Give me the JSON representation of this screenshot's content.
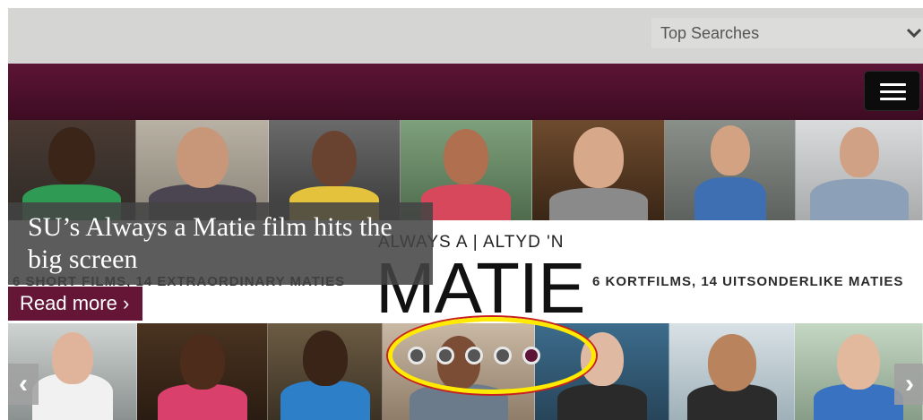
{
  "header": {
    "search_select": {
      "selected": "Top Searches",
      "icon": "chevron-down-icon"
    },
    "menu_button": {
      "icon": "hamburger-icon"
    }
  },
  "banner": {
    "brand_small": "ALWAYS A | ALTYD 'N",
    "brand_large": "MATIE",
    "tagline_en": "6 SHORT FILMS, 14 EXTRAORDINARY MATIES",
    "tagline_af": "6 KORTFILMS, 14 UITSONDERLIKE MATIES",
    "caption_title": "SU’s Always a Matie film hits the big screen",
    "read_more": "Read more ›",
    "prev_arrow": "‹",
    "next_arrow": "›",
    "slides": {
      "count": 5,
      "active_index": 4
    }
  },
  "colors": {
    "brand_maroon": "#5d1436",
    "topbar_grey": "#d5d5d4",
    "annotation_yellow": "#ffea00",
    "annotation_red": "#c8201e"
  }
}
